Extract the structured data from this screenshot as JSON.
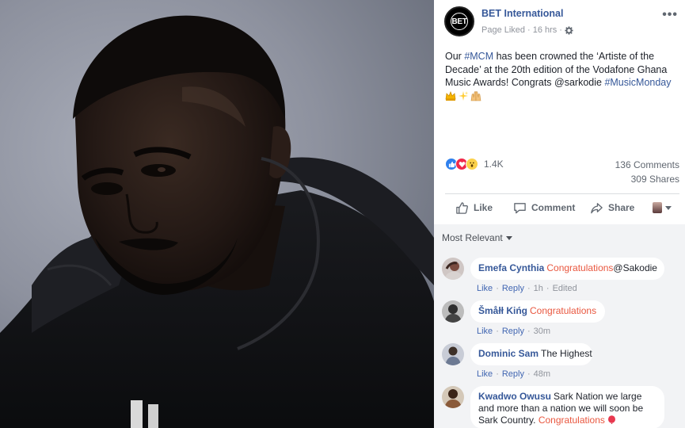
{
  "page": {
    "name": "BET International",
    "avatar_text": "BET",
    "meta_liked": "Page Liked",
    "meta_time": "16 hrs",
    "more": "•••"
  },
  "post": {
    "text_1": "Our ",
    "tag_mcm": "#MCM",
    "text_2": " has been crowned the ‘Artiste of the Decade’ at the 20th edition of the Vodafone Ghana Music Awards! Congrats @sarkodie ",
    "tag_music": "#MusicMonday",
    "emojis": [
      "crown",
      "sparkles",
      "raised-hands"
    ]
  },
  "stats": {
    "reactions_count": "1.4K",
    "comments": "136 Comments",
    "shares": "309 Shares"
  },
  "actions": {
    "like": "Like",
    "comment": "Comment",
    "share": "Share"
  },
  "sort_label": "Most Relevant",
  "comments": [
    {
      "author": "Emefa Cynthia",
      "highlight": "Congratulations",
      "text": "@Sakodie",
      "like": "Like",
      "reply": "Reply",
      "time": "1h",
      "edited": "Edited"
    },
    {
      "author": "Šmåłł Kińg",
      "highlight": "Congratulations",
      "text": "",
      "like": "Like",
      "reply": "Reply",
      "time": "30m"
    },
    {
      "author": "Dominic Sam",
      "highlight": "",
      "text": "The Highest",
      "like": "Like",
      "reply": "Reply",
      "time": "48m"
    },
    {
      "author": "Kwadwo Owusu",
      "text_1": "Sark Nation we large and more than a nation we will soon be Sark Country. ",
      "highlight": "Congratulations",
      "emoji": "balloon"
    }
  ],
  "colors": {
    "link": "#365899",
    "highlight": "#e9573f",
    "muted": "#90949c",
    "comment_bg": "#f2f3f5"
  }
}
